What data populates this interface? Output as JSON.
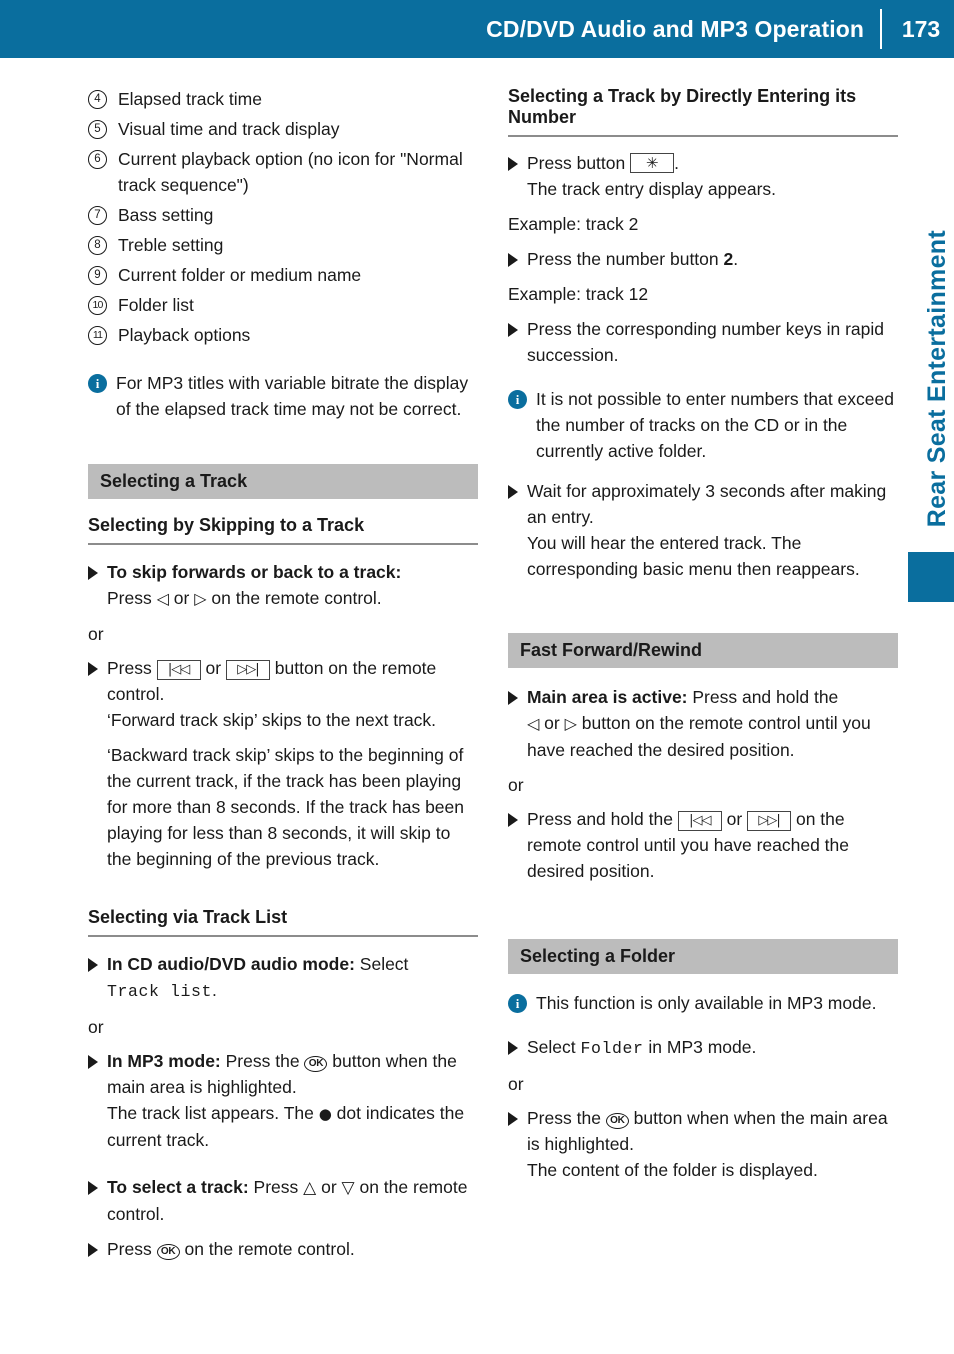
{
  "header": {
    "title": "CD/DVD Audio and MP3 Operation",
    "page_number": "173",
    "bg_color": "#0a6e9e"
  },
  "side_tab": {
    "label": "Rear Seat Entertainment",
    "color": "#0a6e9e"
  },
  "left_column": {
    "legend_items": [
      {
        "number": "4",
        "text": "Elapsed track time"
      },
      {
        "number": "5",
        "text": "Visual time and track display"
      },
      {
        "number": "6",
        "text": "Current playback option (no icon for \"Normal track sequence\")"
      },
      {
        "number": "7",
        "text": "Bass setting"
      },
      {
        "number": "8",
        "text": "Treble setting"
      },
      {
        "number": "9",
        "text": "Current folder or medium name"
      },
      {
        "number": "10",
        "text": "Folder list"
      },
      {
        "number": "11",
        "text": "Playback options"
      }
    ],
    "note": "For MP3 titles with variable bitrate the display of the elapsed track time may not be correct.",
    "section_title": "Selecting a Track",
    "sub_head_1": "Selecting by Skipping to a Track",
    "step1_bold": "To skip forwards or back to a track:",
    "step1_line2_pre": "Press ",
    "step1_left_arrow": "◁",
    "step1_mid": " or ",
    "step1_right_arrow": "▷",
    "step1_post": " on the remote control.",
    "or_label": "or",
    "step2_pre": "Press ",
    "step2_btn_back": "|◁◁",
    "step2_mid": " or ",
    "step2_btn_fwd": "▷▷|",
    "step2_post": " button on the remote control.",
    "step2_extra_1": "‘Forward track skip’ skips to the next track.",
    "step2_extra_2": "‘Backward track skip’ skips to the beginning of the current track, if the track has been playing for more than 8 seconds. If the track has been playing for less than 8 seconds, it will skip to the beginning of the previous track.",
    "sub_head_2": "Selecting via Track List",
    "step3_bold": "In CD audio/DVD audio mode:",
    "step3_rest": " Select",
    "step3_mono": "Track list",
    "step3_period": ".",
    "step4_bold": "In MP3 mode:",
    "step4_pre": " Press the ",
    "step4_ok": "OK",
    "step4_post": " button when the main area is highlighted.",
    "step4_extra_pre": "The track list appears. The ",
    "step4_extra_dot": "●",
    "step4_extra_post": " dot indicates the current track.",
    "step5_bold": "To select a track:",
    "step5_pre": " Press ",
    "step5_up": "△",
    "step5_mid": " or ",
    "step5_down": "▽",
    "step5_post": " on the remote control.",
    "step6_pre": "Press ",
    "step6_ok": "OK",
    "step6_post": " on the remote control."
  },
  "right_column": {
    "heading": "Selecting a Track by Directly Entering its Number",
    "step1_pre": "Press button ",
    "step1_btn": "✳",
    "step1_post": ".",
    "step1_extra": "The track entry display appears.",
    "example_1": "Example: track 2",
    "step2_pre": "Press the number button ",
    "step2_bold": "2",
    "step2_post": ".",
    "example_2": "Example: track 12",
    "step3": "Press the corresponding number keys in rapid succession.",
    "note_1": "It is not possible to enter numbers that exceed the number of tracks on the CD or in the currently active folder.",
    "step4": "Wait for approximately 3 seconds after making an entry.",
    "step4_extra": "You will hear the entered track. The corresponding basic menu then reappears.",
    "section_title_ff": "Fast Forward/Rewind",
    "ff_step1_bold": "Main area is active:",
    "ff_step1_pre": " Press and hold the ",
    "ff_left_arrow": "◁",
    "ff_mid": " or ",
    "ff_right_arrow": "▷",
    "ff_step1_post": " button on the remote control until you have reached the desired position.",
    "or_label": "or",
    "ff_step2_pre": "Press and hold the ",
    "ff_btn_back": "|◁◁",
    "ff_btn_mid": " or ",
    "ff_btn_fwd": "▷▷|",
    "ff_step2_post": " on the remote control until you have reached the desired position.",
    "section_title_folder": "Selecting a Folder",
    "folder_note": "This function is only available in MP3 mode.",
    "folder_step1_pre": "Select ",
    "folder_step1_mono": "Folder",
    "folder_step1_post": " in MP3 mode.",
    "folder_or": "or",
    "folder_step2_pre": "Press the ",
    "folder_step2_ok": "OK",
    "folder_step2_post": " button when when the main area is highlighted.",
    "folder_step2_extra": "The content of the folder is displayed."
  }
}
